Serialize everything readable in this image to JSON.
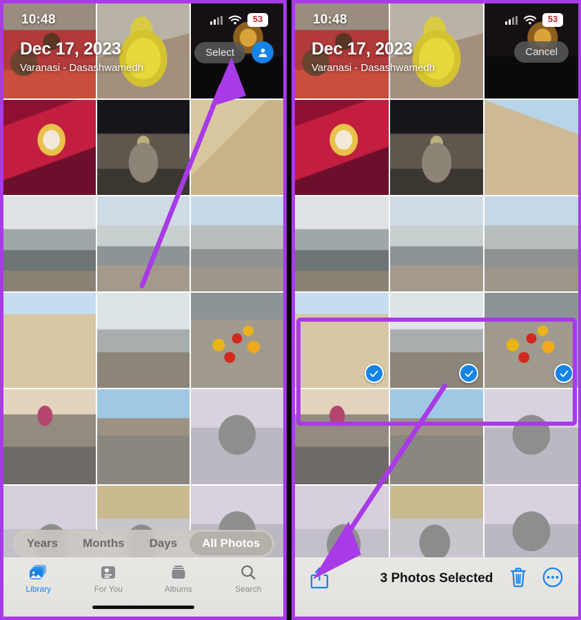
{
  "meta": {
    "app": "Photos",
    "accent_blue": "#1583e8",
    "annotation_purple": "#a93ae8",
    "toolbar_bg": "#e6e4e1"
  },
  "status_bar": {
    "time": "10:48",
    "cellular_icon": "cellular-bars-icon",
    "wifi_icon": "wifi-icon",
    "battery_text": "53",
    "battery_color": "#c0272d"
  },
  "left_panel": {
    "header": {
      "date": "Dec 17, 2023",
      "location": "Varanasi - Dasashwamedh",
      "select_label": "Select",
      "avatar_icon": "person-icon"
    },
    "segmented_control": {
      "options": [
        "Years",
        "Months",
        "Days",
        "All Photos"
      ],
      "selected": "All Photos"
    },
    "tab_bar": {
      "tabs": [
        {
          "label": "Library",
          "icon": "library-icon",
          "active": true
        },
        {
          "label": "For You",
          "icon": "for-you-icon",
          "active": false
        },
        {
          "label": "Albums",
          "icon": "albums-icon",
          "active": false
        },
        {
          "label": "Search",
          "icon": "search-icon",
          "active": false
        }
      ]
    },
    "grid": [
      [
        "portrait-group",
        "yellow-sweet",
        "shrine-dark"
      ],
      [
        "red-hall",
        "dark-hall",
        "jantar-mantar"
      ],
      [
        "ghat-boats-1",
        "ghat-boats-2",
        "ghat-boats-3"
      ],
      [
        "stone-stairs",
        "ghat-market-boats",
        "marigold-flowers"
      ],
      [
        "riverside-market",
        "street-corridor",
        "car-mirror"
      ],
      [
        "car-interior-1",
        "car-interior-2",
        "car-interior-3"
      ]
    ]
  },
  "right_panel": {
    "header": {
      "date": "Dec 17, 2023",
      "location": "Varanasi - Dasashwamedh",
      "cancel_label": "Cancel"
    },
    "selection_toolbar": {
      "share_icon": "share-icon",
      "status_text": "3 Photos Selected",
      "trash_icon": "trash-icon",
      "more_icon": "more-circle-icon"
    },
    "selected_photos": [
      "stone-stairs",
      "ghat-market-boats",
      "marigold-flowers"
    ],
    "selected_count": 3,
    "grid": [
      [
        "portrait-group",
        "yellow-sweet",
        "shrine-dark"
      ],
      [
        "red-hall",
        "dark-hall",
        "jantar-mantar"
      ],
      [
        "ghat-boats-1",
        "ghat-boats-2",
        "ghat-boats-3"
      ],
      [
        "stone-stairs",
        "ghat-market-boats",
        "marigold-flowers"
      ],
      [
        "riverside-market",
        "street-corridor",
        "car-mirror"
      ],
      [
        "car-interior-1",
        "car-interior-2",
        "car-interior-3"
      ]
    ]
  },
  "annotations": {
    "left_arrow": "arrow-pointing-to-select-button",
    "right_arrow": "arrow-pointing-to-share-button",
    "right_highlight_box": "highlight-around-selected-row"
  }
}
